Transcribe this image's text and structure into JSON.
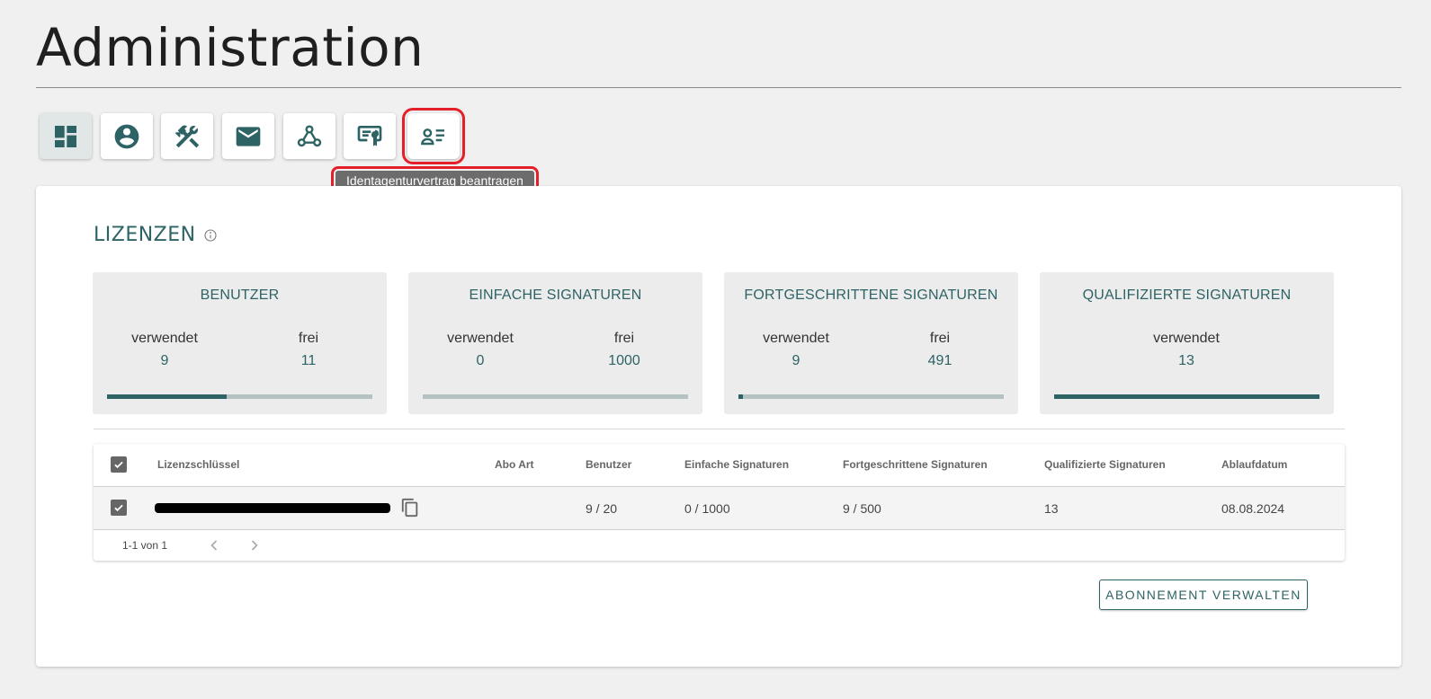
{
  "page": {
    "title": "Administration"
  },
  "toolbar": {
    "buttons": [
      {
        "icon": "dashboard-icon",
        "active": true
      },
      {
        "icon": "account-circle-icon"
      },
      {
        "icon": "tools-icon"
      },
      {
        "icon": "mail-icon"
      },
      {
        "icon": "webhook-icon"
      },
      {
        "icon": "certificate-icon"
      },
      {
        "icon": "contact-list-icon",
        "highlighted": true
      }
    ],
    "tooltip": "Identagenturvertrag beantragen"
  },
  "licenses": {
    "title": "LIZENZEN",
    "stats": [
      {
        "title": "BENUTZER",
        "used_label": "verwendet",
        "used": "9",
        "free_label": "frei",
        "free": "11",
        "fill": 0.45
      },
      {
        "title": "EINFACHE SIGNATUREN",
        "used_label": "verwendet",
        "used": "0",
        "free_label": "frei",
        "free": "1000",
        "fill": 0.0
      },
      {
        "title": "FORTGESCHRITTENE SIGNATUREN",
        "used_label": "verwendet",
        "used": "9",
        "free_label": "frei",
        "free": "491",
        "fill": 0.018
      },
      {
        "title": "QUALIFIZIERTE SIGNATUREN",
        "used_label": "verwendet",
        "used": "13",
        "fill": 1.0
      }
    ]
  },
  "table": {
    "headers": {
      "key": "Lizenzschlüssel",
      "abo": "Abo Art",
      "users": "Benutzer",
      "simple": "Einfache Signaturen",
      "advanced": "Fortgeschrittene Signaturen",
      "qualified": "Qualifizierte Signaturen",
      "expiry": "Ablaufdatum"
    },
    "rows": [
      {
        "abo": "",
        "users": "9 / 20",
        "simple": "0 / 1000",
        "advanced": "9 / 500",
        "qualified": "13",
        "expiry": "08.08.2024"
      }
    ],
    "pagination": "1-1 von 1"
  },
  "actions": {
    "manage": "ABONNEMENT VERWALTEN"
  },
  "colors": {
    "accent": "#2e6365",
    "highlight": "#e3202a"
  }
}
